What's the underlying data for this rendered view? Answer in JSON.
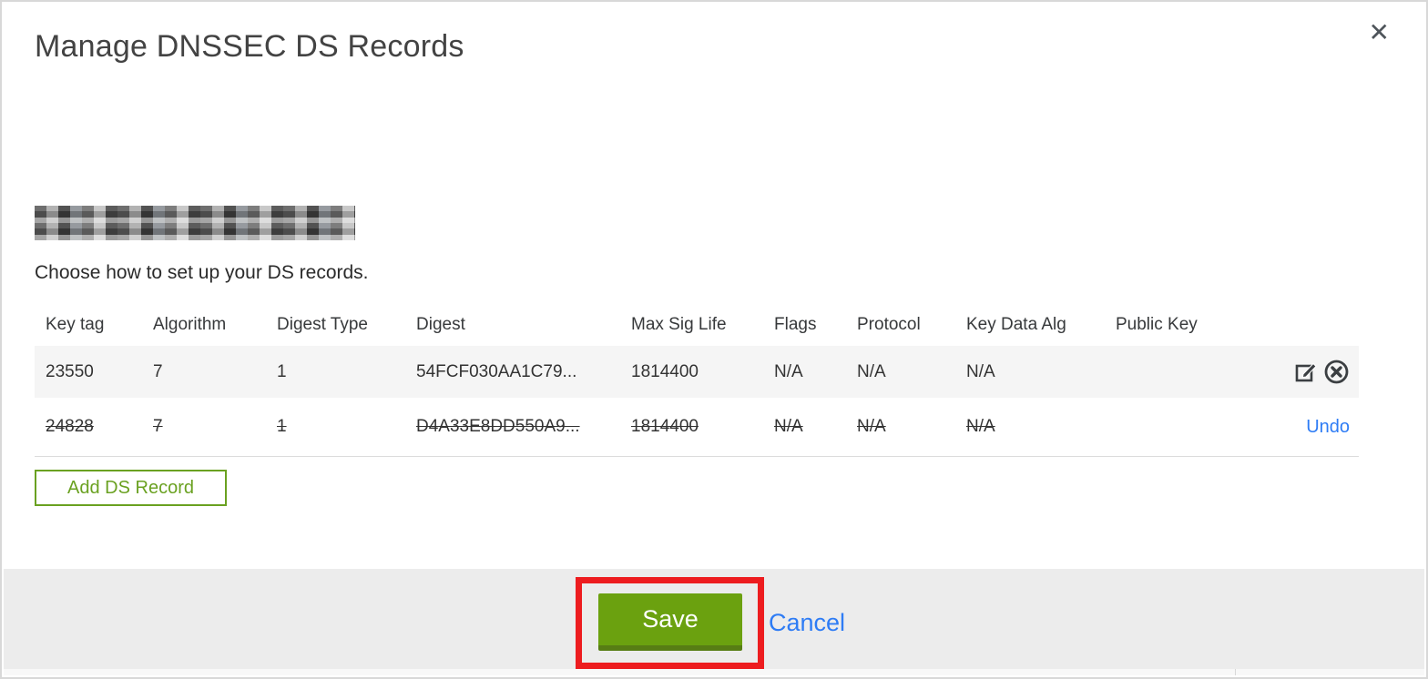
{
  "modal": {
    "title": "Manage DNSSEC DS Records",
    "close_label": "✕",
    "instruction": "Choose how to set up your DS records."
  },
  "table": {
    "headers": [
      "Key tag",
      "Algorithm",
      "Digest Type",
      "Digest",
      "Max Sig Life",
      "Flags",
      "Protocol",
      "Key Data Alg",
      "Public Key"
    ],
    "rows": [
      {
        "key_tag": "23550",
        "algorithm": "7",
        "digest_type": "1",
        "digest": "54FCF030AA1C79...",
        "max_sig_life": "1814400",
        "flags": "N/A",
        "protocol": "N/A",
        "key_data_alg": "N/A",
        "public_key": "",
        "state": "active"
      },
      {
        "key_tag": "24828",
        "algorithm": "7",
        "digest_type": "1",
        "digest": "D4A33E8DD550A9...",
        "max_sig_life": "1814400",
        "flags": "N/A",
        "protocol": "N/A",
        "key_data_alg": "N/A",
        "public_key": "",
        "state": "deleted",
        "undo_label": "Undo"
      }
    ]
  },
  "buttons": {
    "add_ds_record": "Add DS Record",
    "save": "Save",
    "cancel": "Cancel"
  },
  "icons": {
    "edit": "edit-icon",
    "delete": "delete-icon",
    "close": "close-icon"
  },
  "colors": {
    "accent_green": "#6ba10f",
    "green_border": "#6aa121",
    "link_blue": "#2e7cf5",
    "annotation_red": "#ed1c1f",
    "footer_gray": "#ececec",
    "row_alt_gray": "#f5f5f5"
  }
}
